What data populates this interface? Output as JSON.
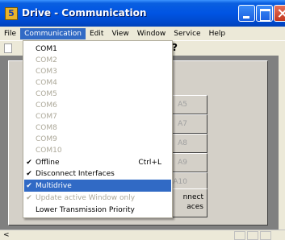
{
  "window": {
    "title": "Drive - Communication",
    "icon_glyph": "5"
  },
  "menubar": {
    "items": [
      "File",
      "Communication",
      "Edit",
      "View",
      "Window",
      "Service",
      "Help"
    ],
    "active": "Communication"
  },
  "toolbar": {
    "help_cursor_glyph": "?"
  },
  "dropdown": {
    "items": [
      {
        "label": "COM1",
        "enabled": true,
        "checked": false,
        "shortcut": ""
      },
      {
        "label": "COM2",
        "enabled": false,
        "checked": false,
        "shortcut": ""
      },
      {
        "label": "COM3",
        "enabled": false,
        "checked": false,
        "shortcut": ""
      },
      {
        "label": "COM4",
        "enabled": false,
        "checked": false,
        "shortcut": ""
      },
      {
        "label": "COM5",
        "enabled": false,
        "checked": false,
        "shortcut": ""
      },
      {
        "label": "COM6",
        "enabled": false,
        "checked": false,
        "shortcut": ""
      },
      {
        "label": "COM7",
        "enabled": false,
        "checked": false,
        "shortcut": ""
      },
      {
        "label": "COM8",
        "enabled": false,
        "checked": false,
        "shortcut": ""
      },
      {
        "label": "COM9",
        "enabled": false,
        "checked": false,
        "shortcut": ""
      },
      {
        "label": "COM10",
        "enabled": false,
        "checked": false,
        "shortcut": ""
      },
      {
        "label": "Offline",
        "enabled": true,
        "checked": true,
        "shortcut": "Ctrl+L"
      },
      {
        "label": "Disconnect Interfaces",
        "enabled": true,
        "checked": true,
        "shortcut": ""
      },
      {
        "label": "Multidrive",
        "enabled": true,
        "checked": true,
        "shortcut": "",
        "highlighted": true
      },
      {
        "label": "Update active Window only",
        "enabled": false,
        "checked": true,
        "shortcut": ""
      },
      {
        "label": "Lower Transmission Priority",
        "enabled": true,
        "checked": false,
        "shortcut": ""
      }
    ],
    "check_glyph": "✔"
  },
  "child_window": {
    "address_buttons": [
      "A5",
      "A7",
      "A8",
      "A9",
      "A10"
    ],
    "connect_label": [
      "nnect",
      "aces"
    ]
  },
  "scrollbar": {
    "left_glyph": "<"
  }
}
